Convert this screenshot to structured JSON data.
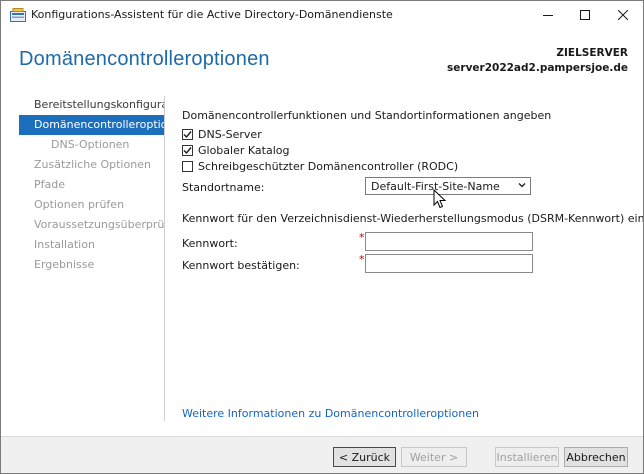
{
  "window": {
    "title": "Konfigurations-Assistent für die Active Directory-Domänendienste"
  },
  "header": {
    "page_title": "Domänencontrolleroptionen",
    "target_label": "ZIELSERVER",
    "target_value": "server2022ad2.pampersjoe.de"
  },
  "nav": {
    "items": [
      {
        "label": "Bereitstellungskonfigurati...",
        "state": "done"
      },
      {
        "label": "Domänencontrolleroption...",
        "state": "active"
      },
      {
        "label": "DNS-Optionen",
        "state": "disabled"
      },
      {
        "label": "Zusätzliche Optionen",
        "state": "disabled"
      },
      {
        "label": "Pfade",
        "state": "disabled"
      },
      {
        "label": "Optionen prüfen",
        "state": "disabled"
      },
      {
        "label": "Voraussetzungsüberprüfu...",
        "state": "disabled"
      },
      {
        "label": "Installation",
        "state": "disabled"
      },
      {
        "label": "Ergebnisse",
        "state": "disabled"
      }
    ]
  },
  "content": {
    "section_heading": "Domänencontrollerfunktionen und Standortinformationen angeben",
    "checkboxes": [
      {
        "label": "DNS-Server",
        "checked": true
      },
      {
        "label": "Globaler Katalog",
        "checked": true
      },
      {
        "label": "Schreibgeschützter Domänencontroller (RODC)",
        "checked": false
      }
    ],
    "site_label": "Standortname:",
    "site_value": "Default-First-Site-Name",
    "dsrm_heading": "Kennwort für den Verzeichnisdienst-Wiederherstellungsmodus (DSRM-Kennwort) eingeben",
    "password_label": "Kennwort:",
    "confirm_label": "Kennwort bestätigen:",
    "required_marker": "*",
    "more_link": "Weitere Informationen zu Domänencontrolleroptionen"
  },
  "footer": {
    "back": "< Zurück",
    "next": "Weiter >",
    "install": "Installieren",
    "cancel": "Abbrechen"
  },
  "colors": {
    "accent": "#1c6fbd",
    "title": "#1e6aa8",
    "link": "#1565c0",
    "required": "#c00000"
  }
}
